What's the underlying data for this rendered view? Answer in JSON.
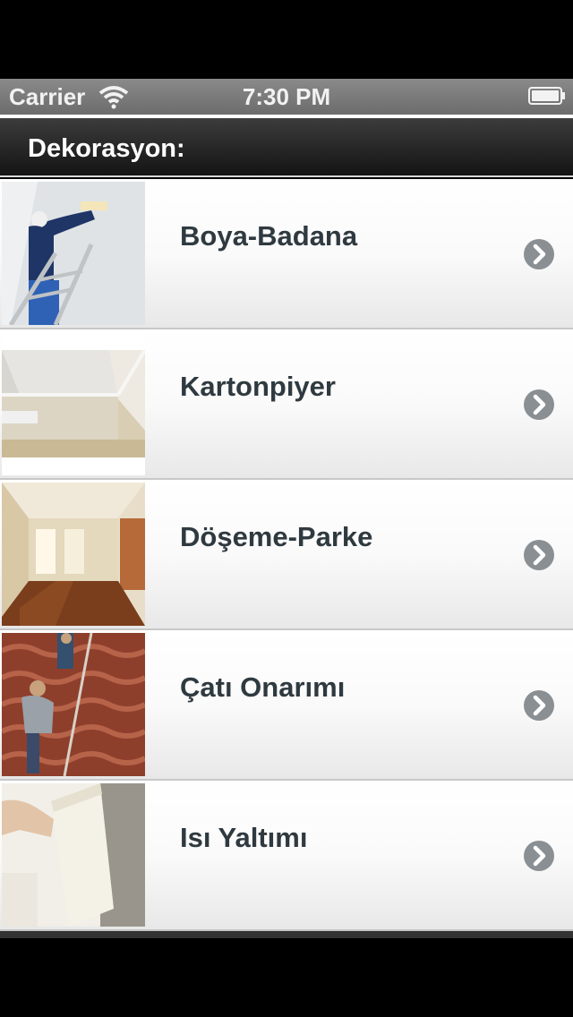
{
  "status_bar": {
    "carrier": "Carrier",
    "time": "7:30 PM",
    "wifi_icon": "wifi-icon",
    "battery_icon": "battery-icon"
  },
  "nav": {
    "title": "Dekorasyon:"
  },
  "items": [
    {
      "label": "Boya-Badana",
      "thumb": "painter-on-ladder-photo",
      "icon": "chevron-right-circle-icon"
    },
    {
      "label": "Kartonpiyer",
      "thumb": "ceiling-molding-photo",
      "icon": "chevron-right-circle-icon"
    },
    {
      "label": "Döşeme-Parke",
      "thumb": "parquet-room-photo",
      "icon": "chevron-right-circle-icon"
    },
    {
      "label": "Çatı Onarımı",
      "thumb": "roof-tiles-repair-photo",
      "icon": "chevron-right-circle-icon"
    },
    {
      "label": "Isı Yaltımı",
      "thumb": "wall-insulation-photo",
      "icon": "chevron-right-circle-icon"
    }
  ],
  "colors": {
    "label_text": "#2f3a40",
    "chevron": "#8a8f93",
    "nav_bar": "#2a2a2a",
    "status_bar": "#7a7a7a"
  }
}
